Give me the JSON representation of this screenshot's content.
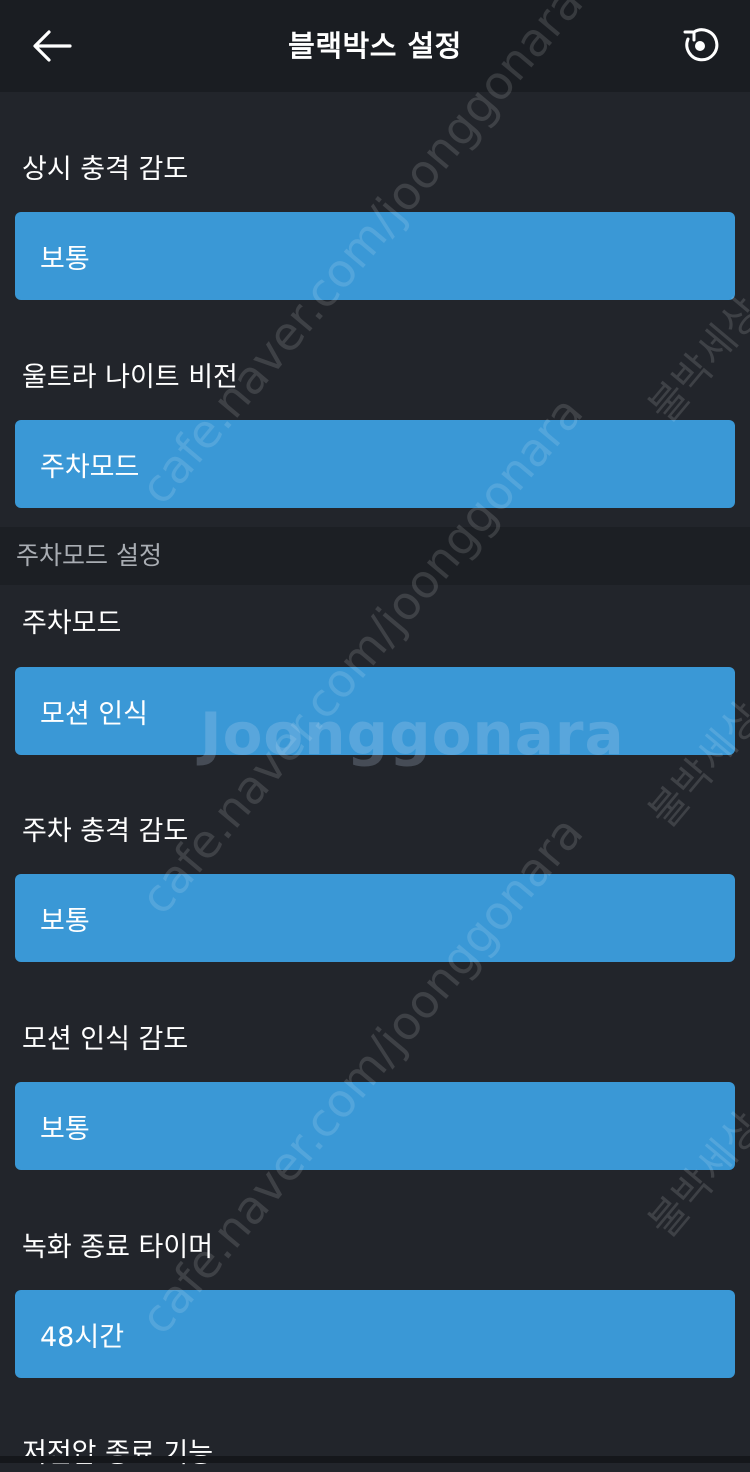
{
  "header": {
    "title": "블랙박스 설정",
    "back_icon": "arrow-left-icon",
    "reset_icon": "reset-icon"
  },
  "settings": [
    {
      "label": "상시 충격 감도",
      "value": "보통"
    },
    {
      "label": "울트라 나이트 비전",
      "value": "주차모드"
    }
  ],
  "parking_section": {
    "title": "주차모드 설정",
    "settings": [
      {
        "label": "주차모드",
        "value": "모션 인식"
      },
      {
        "label": "주차 충격 감도",
        "value": "보통"
      },
      {
        "label": "모션 인식 감도",
        "value": "보통"
      },
      {
        "label": "녹화 종료 타이머",
        "value": "48시간"
      },
      {
        "label": "저전압 종료 기능"
      }
    ]
  },
  "watermark": {
    "url": "cafe.naver.com/joonggonara",
    "brand": "Joonggonara",
    "side": "불박세상"
  },
  "colors": {
    "background": "#22252b",
    "app_bar": "#1a1d22",
    "dropdown": "#3a98d6",
    "section_header": "#1c1f24"
  }
}
